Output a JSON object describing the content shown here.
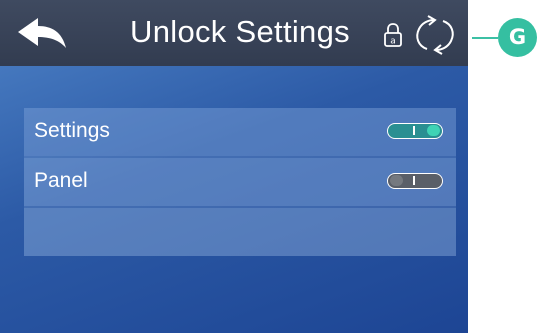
{
  "header": {
    "title": "Unlock Settings",
    "back_icon": "back-arrow-icon",
    "lock_icon": "lock-icon",
    "refresh_icon": "refresh-icon"
  },
  "panel": {
    "rows": [
      {
        "label": "Settings",
        "toggle_state": "on"
      },
      {
        "label": "Panel",
        "toggle_state": "off"
      },
      {
        "label": ""
      }
    ]
  },
  "callout": {
    "label": "G"
  },
  "colors": {
    "header_bg": "#363f53",
    "screen_bg": "#2c5aa6",
    "toggle_on": "#2a8f92",
    "toggle_knob_on": "#3fd3b5",
    "toggle_off": "#5a5f68",
    "callout": "#35bfa1"
  }
}
